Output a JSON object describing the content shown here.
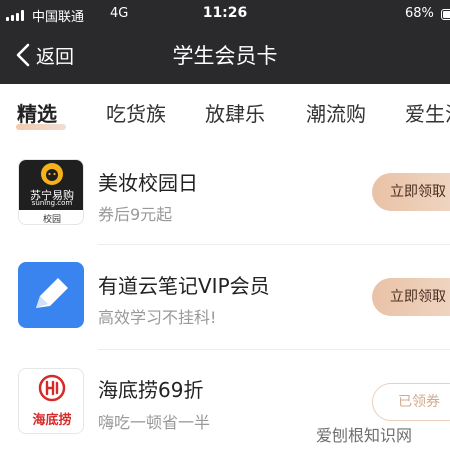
{
  "status_bar": {
    "carrier": "中国联通",
    "network": "4G",
    "time": "11:26",
    "battery": "68%",
    "battery_level": 0.68
  },
  "nav": {
    "back_label": "返回",
    "title": "学生会员卡"
  },
  "tabs": [
    {
      "label": "精选",
      "active": true
    },
    {
      "label": "吃货族",
      "active": false
    },
    {
      "label": "放肆乐",
      "active": false
    },
    {
      "label": "潮流购",
      "active": false
    },
    {
      "label": "爱生活",
      "active": false
    }
  ],
  "items": [
    {
      "name": "美妆校园日",
      "desc": "券后9元起",
      "button": "立即领取",
      "button_state": "claim",
      "logo": {
        "brand": "苏宁易购",
        "domain": "suning.com",
        "tag": "校园",
        "icon": "suning-lion-icon"
      }
    },
    {
      "name": "有道云笔记VIP会员",
      "desc": "高效学习不挂科!",
      "button": "立即领取",
      "button_state": "claim",
      "logo": {
        "icon": "youdao-note-pen-icon",
        "color": "#3a84f0"
      }
    },
    {
      "name": "海底捞69折",
      "desc": "嗨吃一顿省一半",
      "button": "已领券",
      "button_state": "claimed",
      "logo": {
        "brand": "海底捞",
        "icon": "haidilao-emblem-icon",
        "color": "#d62a2a"
      }
    }
  ],
  "watermark": "爱刨根知识网",
  "colors": {
    "header_bg": "#2a2a2c",
    "accent": "#e9c2a6",
    "haidilao_red": "#d62a2a",
    "youdao_blue": "#3a84f0"
  }
}
